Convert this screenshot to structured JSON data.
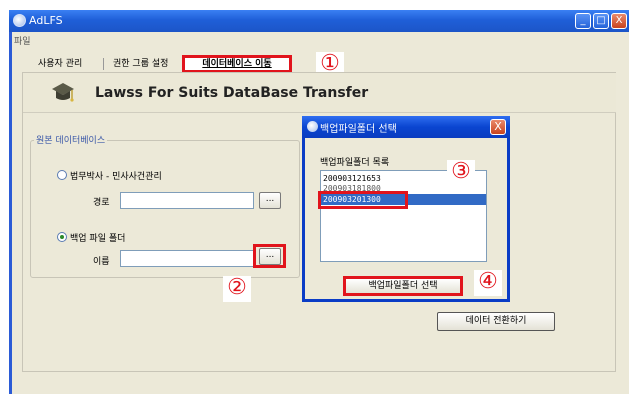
{
  "window": {
    "title": "AdLFS",
    "minimize": "_",
    "maximize": "□",
    "close": "X"
  },
  "menu": {
    "file": "파일"
  },
  "tabs": [
    "사용자 관리",
    "권한 그룹 설정",
    "데이터베이스 이동"
  ],
  "header": {
    "title": "Lawss For Suits  DataBase Transfer",
    "icon": "graduation-cap-icon"
  },
  "group": {
    "label": "원본 데이터베이스",
    "option1": "법무박사 - 민사사건관리",
    "path_label": "경로",
    "option2": "백업 파일 폴더",
    "name_label": "이름",
    "browse": "..."
  },
  "convert_button": "데이터 전환하기",
  "dialog": {
    "title": "백업파일폴더 선택",
    "list_label": "백업파일폴더 목록",
    "items": [
      "200903121653",
      "200903181800",
      "200903201300"
    ],
    "select_button": "백업파일폴더 선택",
    "close": "X"
  },
  "markers": [
    "①",
    "②",
    "③",
    "④"
  ],
  "colors": {
    "highlight": "#e1141c",
    "titlebar": "#1f5fd8",
    "selection": "#316ac5"
  }
}
